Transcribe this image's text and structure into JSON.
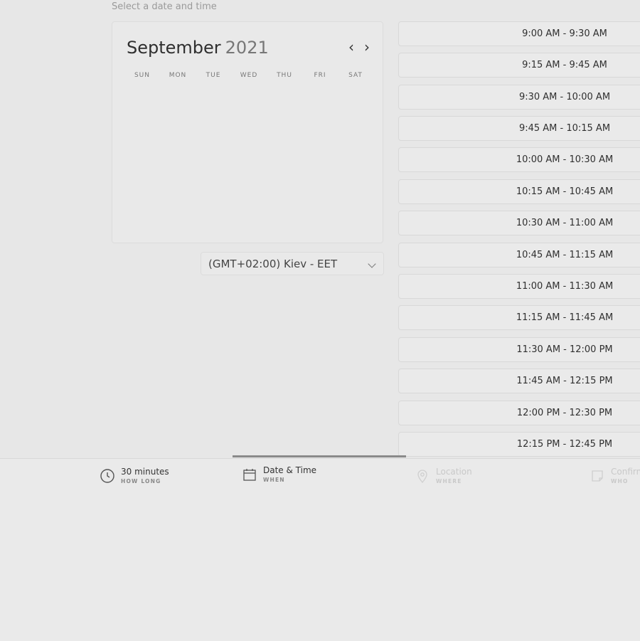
{
  "subtitle": "Select a date and time",
  "calendar": {
    "month": "September",
    "year": "2021",
    "prev_icon": "chevron-left-icon",
    "next_icon": "chevron-right-icon",
    "weekdays": [
      "SUN",
      "MON",
      "TUE",
      "WED",
      "THU",
      "FRI",
      "SAT"
    ]
  },
  "timezone": {
    "selected": "(GMT+02:00) Kiev - EET",
    "icon": "chevron-down-icon"
  },
  "slots": [
    "9:00 AM - 9:30 AM",
    "9:15 AM - 9:45 AM",
    "9:30 AM - 10:00 AM",
    "9:45 AM - 10:15 AM",
    "10:00 AM - 10:30 AM",
    "10:15 AM - 10:45 AM",
    "10:30 AM - 11:00 AM",
    "10:45 AM - 11:15 AM",
    "11:00 AM - 11:30 AM",
    "11:15 AM - 11:45 AM",
    "11:30 AM - 12:00 PM",
    "11:45 AM - 12:15 PM",
    "12:00 PM - 12:30 PM",
    "12:15 PM - 12:45 PM"
  ],
  "steps": [
    {
      "label": "30 minutes",
      "sub": "HOW LONG",
      "icon": "clock-icon"
    },
    {
      "label": "Date & Time",
      "sub": "WHEN",
      "icon": "calendar-icon"
    },
    {
      "label": "Location",
      "sub": "WHERE",
      "icon": "location-pin-icon"
    },
    {
      "label": "Confirm",
      "sub": "WHO",
      "icon": "note-icon"
    }
  ],
  "colors": {
    "background": "#e7e7e7",
    "active_step_line": "#8a8a8a"
  }
}
